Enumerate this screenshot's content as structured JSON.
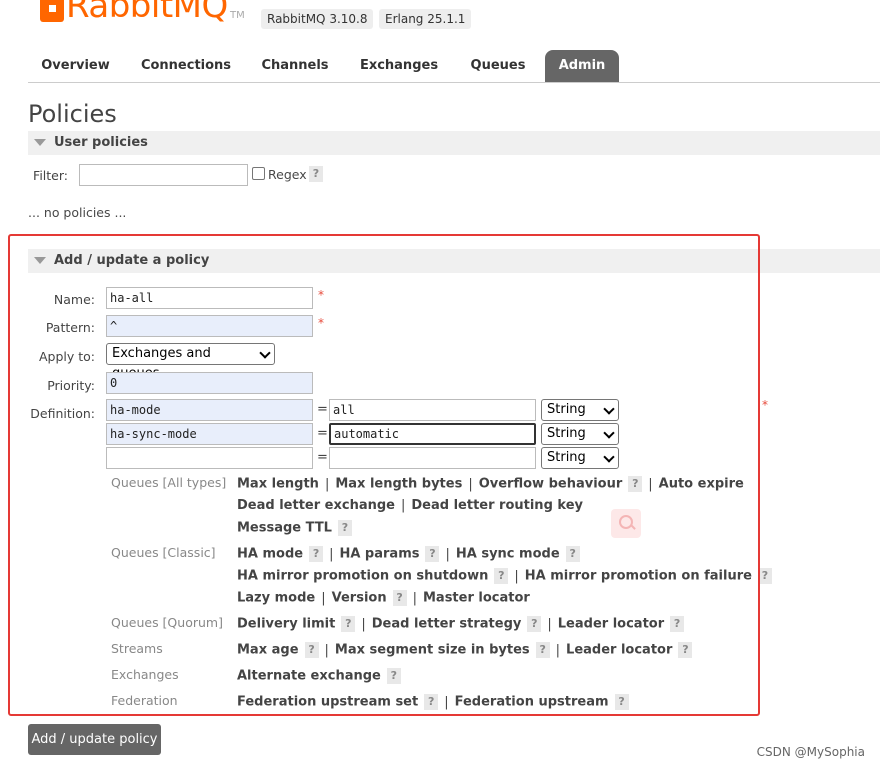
{
  "header": {
    "logo_text": "RabbitMQ",
    "logo_tm": "TM",
    "version": "RabbitMQ 3.10.8",
    "erlang": "Erlang 25.1.1"
  },
  "tabs": [
    {
      "label": "Overview"
    },
    {
      "label": "Connections"
    },
    {
      "label": "Channels"
    },
    {
      "label": "Exchanges"
    },
    {
      "label": "Queues"
    },
    {
      "label": "Admin",
      "active": true
    }
  ],
  "page": {
    "title": "Policies",
    "user_policies": {
      "heading": "User policies",
      "filter_label": "Filter:",
      "filter_value": "",
      "regex_label": "Regex",
      "regex_checked": false,
      "help": "?",
      "empty_text": "... no policies ..."
    },
    "add_policy": {
      "heading": "Add / update a policy",
      "name_label": "Name:",
      "name_value": "ha-all",
      "pattern_label": "Pattern:",
      "pattern_value": "^",
      "apply_label": "Apply to:",
      "apply_value": "Exchanges and queues",
      "priority_label": "Priority:",
      "priority_value": "0",
      "definition_label": "Definition:",
      "required_mark": "*",
      "equals": "=",
      "definition_rows": [
        {
          "key": "ha-mode",
          "value": "all",
          "type": "String"
        },
        {
          "key": "ha-sync-mode",
          "value": "automatic",
          "type": "String"
        },
        {
          "key": "",
          "value": "",
          "type": "String"
        }
      ]
    },
    "option_groups": {
      "all_types": {
        "category": "Queues [All types]",
        "max_length": "Max length",
        "max_length_bytes": "Max length bytes",
        "overflow": "Overflow behaviour",
        "auto_expire": "Auto expire",
        "dlx": "Dead letter exchange",
        "dlrk": "Dead letter routing key",
        "ttl": "Message TTL"
      },
      "classic": {
        "category": "Queues [Classic]",
        "ha_mode": "HA mode",
        "ha_params": "HA params",
        "ha_sync": "HA sync mode",
        "ha_shutdown": "HA mirror promotion on shutdown",
        "ha_failure": "HA mirror promotion on failure",
        "lazy": "Lazy mode",
        "version": "Version",
        "master_locator": "Master locator"
      },
      "quorum": {
        "category": "Queues [Quorum]",
        "delivery_limit": "Delivery limit",
        "dl_strategy": "Dead letter strategy",
        "leader_locator": "Leader locator"
      },
      "streams": {
        "category": "Streams",
        "max_age": "Max age",
        "max_segment": "Max segment size in bytes",
        "leader_locator": "Leader locator"
      },
      "exchanges": {
        "category": "Exchanges",
        "alt_exchange": "Alternate exchange"
      },
      "federation": {
        "category": "Federation",
        "upstream_set": "Federation upstream set",
        "upstream": "Federation upstream"
      }
    },
    "submit_label": "Add / update policy"
  },
  "watermark": "CSDN @MySophia",
  "colors": {
    "brand": "#ff6600",
    "active_tab": "#666666",
    "highlight": "#e53935",
    "required": "#e74c3c"
  }
}
